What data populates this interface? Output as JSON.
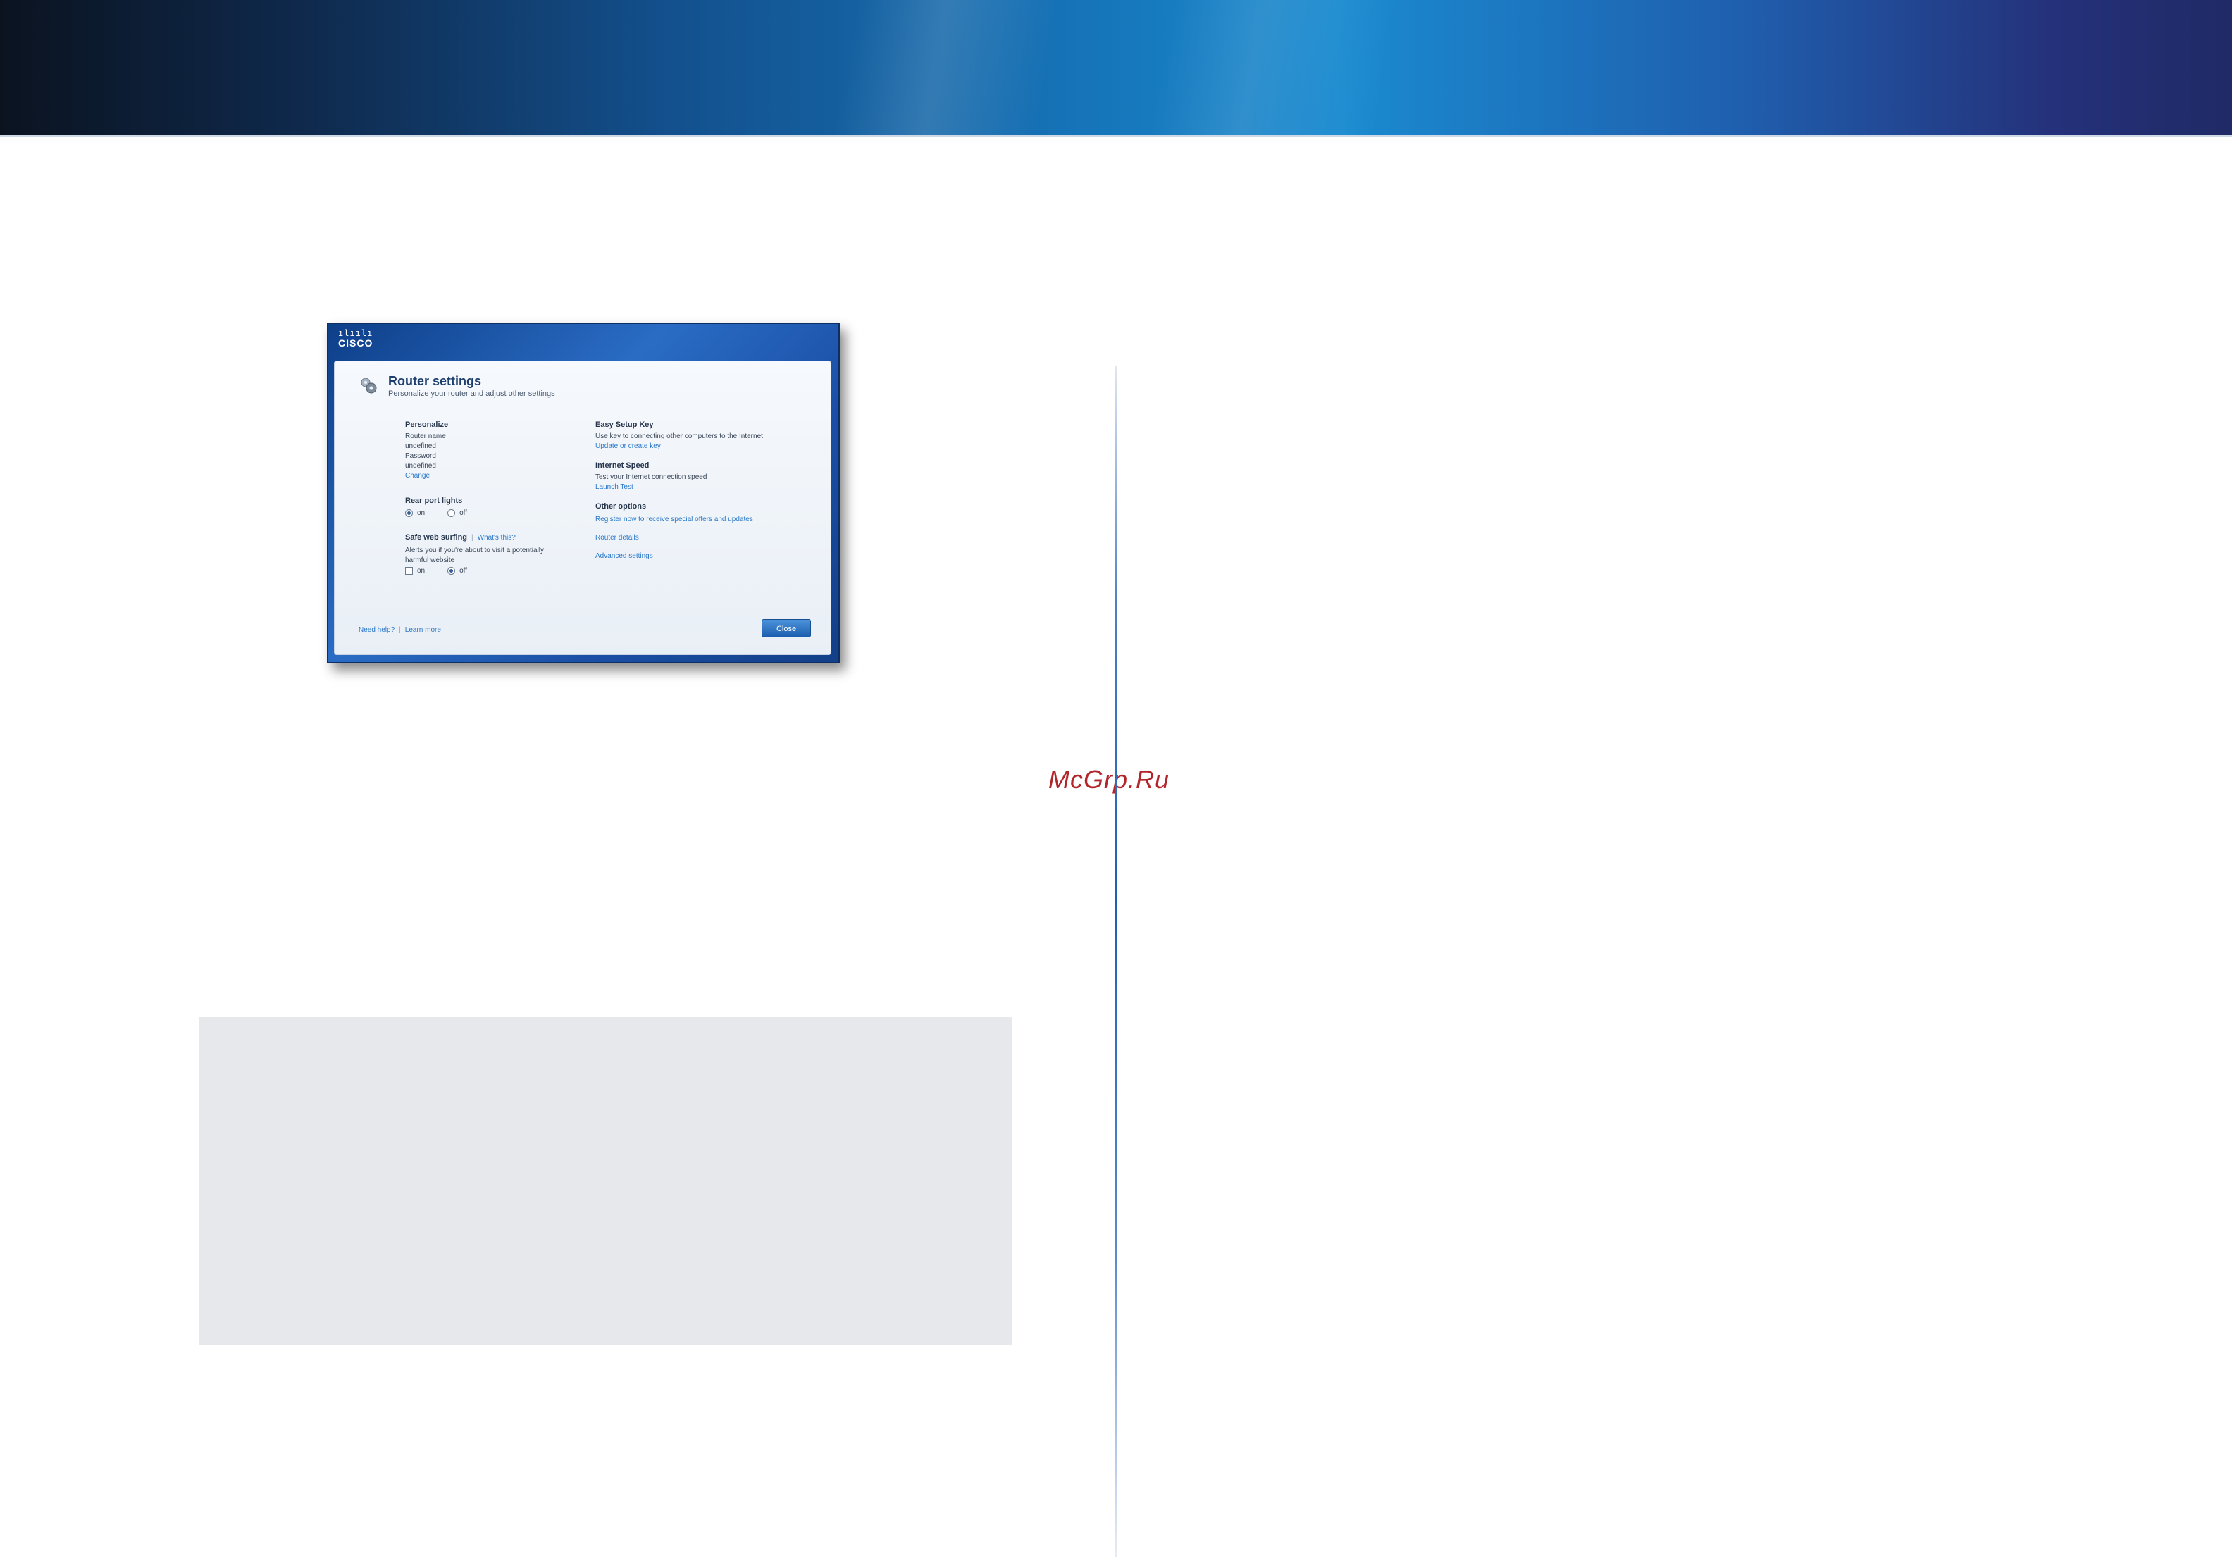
{
  "watermark": "McGrp.Ru",
  "router": {
    "logo": "CISCO",
    "icon": "settings-gear-icon",
    "title": "Router settings",
    "subtitle": "Personalize your router and adjust other settings",
    "personalize": {
      "heading": "Personalize",
      "router_name_label": "Router name",
      "router_name_value": "undefined",
      "password_label": "Password",
      "password_value": "undefined",
      "change_link": "Change"
    },
    "rear_port_lights": {
      "heading": "Rear port lights",
      "on_label": "on",
      "off_label": "off",
      "selected": "on"
    },
    "safe_web_surfing": {
      "heading": "Safe web surfing",
      "whats_this": "What's this?",
      "description": "Alerts you if you're about to visit a potentially harmful website",
      "on_label": "on",
      "off_label": "off",
      "selected": "off"
    },
    "easy_setup_key": {
      "heading": "Easy Setup Key",
      "description": "Use key to connecting other computers to the Internet",
      "link": "Update or create key"
    },
    "internet_speed": {
      "heading": "Internet Speed",
      "description": "Test your Internet connection speed",
      "link": "Launch Test"
    },
    "other_options": {
      "heading": "Other options",
      "links": [
        "Register now to receive special offers and updates",
        "Router details",
        "Advanced settings"
      ]
    },
    "footer": {
      "help_link": "Need help?",
      "learn_link": "Learn more"
    },
    "ok_button": "Close"
  }
}
